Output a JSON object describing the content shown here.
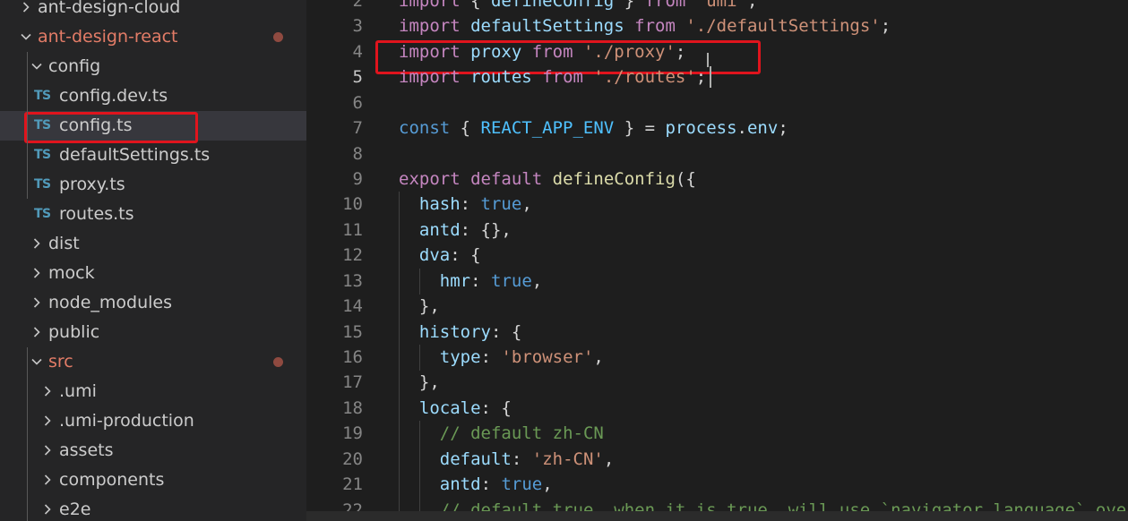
{
  "explorer": {
    "items": [
      {
        "label": "ant-design-cloud",
        "type": "folder",
        "state": "collapsed",
        "depth": 0,
        "modified": false,
        "selected": false
      },
      {
        "label": "ant-design-react",
        "type": "folder",
        "state": "expanded",
        "depth": 0,
        "modified": true,
        "selected": false
      },
      {
        "label": "config",
        "type": "folder",
        "state": "expanded",
        "depth": 1,
        "modified": false,
        "selected": false
      },
      {
        "label": "config.dev.ts",
        "type": "ts-file",
        "depth": 2,
        "modified": false,
        "selected": false
      },
      {
        "label": "config.ts",
        "type": "ts-file",
        "depth": 2,
        "modified": false,
        "selected": true,
        "highlighted": true
      },
      {
        "label": "defaultSettings.ts",
        "type": "ts-file",
        "depth": 2,
        "modified": false,
        "selected": false
      },
      {
        "label": "proxy.ts",
        "type": "ts-file",
        "depth": 2,
        "modified": false,
        "selected": false
      },
      {
        "label": "routes.ts",
        "type": "ts-file",
        "depth": 2,
        "modified": false,
        "selected": false
      },
      {
        "label": "dist",
        "type": "folder",
        "state": "collapsed",
        "depth": 1,
        "modified": false,
        "selected": false
      },
      {
        "label": "mock",
        "type": "folder",
        "state": "collapsed",
        "depth": 1,
        "modified": false,
        "selected": false
      },
      {
        "label": "node_modules",
        "type": "folder",
        "state": "collapsed",
        "depth": 1,
        "modified": false,
        "selected": false
      },
      {
        "label": "public",
        "type": "folder",
        "state": "collapsed",
        "depth": 1,
        "modified": false,
        "selected": false
      },
      {
        "label": "src",
        "type": "folder",
        "state": "expanded",
        "depth": 1,
        "modified": true,
        "selected": false
      },
      {
        "label": ".umi",
        "type": "folder",
        "state": "collapsed",
        "depth": 2,
        "modified": false,
        "selected": false
      },
      {
        "label": ".umi-production",
        "type": "folder",
        "state": "collapsed",
        "depth": 2,
        "modified": false,
        "selected": false
      },
      {
        "label": "assets",
        "type": "folder",
        "state": "collapsed",
        "depth": 2,
        "modified": false,
        "selected": false
      },
      {
        "label": "components",
        "type": "folder",
        "state": "collapsed",
        "depth": 2,
        "modified": false,
        "selected": false
      },
      {
        "label": "e2e",
        "type": "folder",
        "state": "collapsed",
        "depth": 2,
        "modified": false,
        "selected": false
      }
    ],
    "ts_icon_label": "TS"
  },
  "editor": {
    "active_line": 5,
    "highlighted_line": 4,
    "lines": [
      {
        "n": "2",
        "indent": 0,
        "tokens": [
          {
            "t": "import",
            "c": "kw"
          },
          {
            "t": " { ",
            "c": "p"
          },
          {
            "t": "defineConfig",
            "c": "var"
          },
          {
            "t": " } ",
            "c": "p"
          },
          {
            "t": "from",
            "c": "kw"
          },
          {
            "t": " ",
            "c": "p"
          },
          {
            "t": "'umi'",
            "c": "str"
          },
          {
            "t": ";",
            "c": "p"
          }
        ]
      },
      {
        "n": "3",
        "indent": 0,
        "tokens": [
          {
            "t": "import",
            "c": "kw"
          },
          {
            "t": " ",
            "c": "p"
          },
          {
            "t": "defaultSettings",
            "c": "var"
          },
          {
            "t": " ",
            "c": "p"
          },
          {
            "t": "from",
            "c": "kw"
          },
          {
            "t": " ",
            "c": "p"
          },
          {
            "t": "'./defaultSettings'",
            "c": "str"
          },
          {
            "t": ";",
            "c": "p"
          }
        ]
      },
      {
        "n": "4",
        "indent": 0,
        "tokens": [
          {
            "t": "import",
            "c": "kw"
          },
          {
            "t": " ",
            "c": "p"
          },
          {
            "t": "proxy",
            "c": "var"
          },
          {
            "t": " ",
            "c": "p"
          },
          {
            "t": "from",
            "c": "kw"
          },
          {
            "t": " ",
            "c": "p"
          },
          {
            "t": "'./proxy'",
            "c": "str"
          },
          {
            "t": ";",
            "c": "p"
          }
        ]
      },
      {
        "n": "5",
        "indent": 0,
        "tokens": [
          {
            "t": "import",
            "c": "kw"
          },
          {
            "t": " ",
            "c": "p"
          },
          {
            "t": "routes",
            "c": "var"
          },
          {
            "t": " ",
            "c": "p"
          },
          {
            "t": "from",
            "c": "kw"
          },
          {
            "t": " ",
            "c": "p"
          },
          {
            "t": "'./routes'",
            "c": "str"
          },
          {
            "t": ";",
            "c": "p"
          }
        ]
      },
      {
        "n": "6",
        "indent": 0,
        "tokens": []
      },
      {
        "n": "7",
        "indent": 0,
        "tokens": [
          {
            "t": "const",
            "c": "const"
          },
          {
            "t": " { ",
            "c": "p"
          },
          {
            "t": "REACT_APP_ENV",
            "c": "cst"
          },
          {
            "t": " } = ",
            "c": "p"
          },
          {
            "t": "process",
            "c": "var"
          },
          {
            "t": ".",
            "c": "p"
          },
          {
            "t": "env",
            "c": "var"
          },
          {
            "t": ";",
            "c": "p"
          }
        ]
      },
      {
        "n": "8",
        "indent": 0,
        "tokens": []
      },
      {
        "n": "9",
        "indent": 0,
        "tokens": [
          {
            "t": "export",
            "c": "kw"
          },
          {
            "t": " ",
            "c": "p"
          },
          {
            "t": "default",
            "c": "kw"
          },
          {
            "t": " ",
            "c": "p"
          },
          {
            "t": "defineConfig",
            "c": "fn"
          },
          {
            "t": "({",
            "c": "p"
          }
        ]
      },
      {
        "n": "10",
        "indent": 1,
        "tokens": [
          {
            "t": "hash",
            "c": "var"
          },
          {
            "t": ": ",
            "c": "p"
          },
          {
            "t": "true",
            "c": "const"
          },
          {
            "t": ",",
            "c": "p"
          }
        ]
      },
      {
        "n": "11",
        "indent": 1,
        "tokens": [
          {
            "t": "antd",
            "c": "var"
          },
          {
            "t": ": {},",
            "c": "p"
          }
        ]
      },
      {
        "n": "12",
        "indent": 1,
        "tokens": [
          {
            "t": "dva",
            "c": "var"
          },
          {
            "t": ": {",
            "c": "p"
          }
        ]
      },
      {
        "n": "13",
        "indent": 2,
        "tokens": [
          {
            "t": "hmr",
            "c": "var"
          },
          {
            "t": ": ",
            "c": "p"
          },
          {
            "t": "true",
            "c": "const"
          },
          {
            "t": ",",
            "c": "p"
          }
        ]
      },
      {
        "n": "14",
        "indent": 1,
        "tokens": [
          {
            "t": "},",
            "c": "p"
          }
        ]
      },
      {
        "n": "15",
        "indent": 1,
        "tokens": [
          {
            "t": "history",
            "c": "var"
          },
          {
            "t": ": {",
            "c": "p"
          }
        ]
      },
      {
        "n": "16",
        "indent": 2,
        "tokens": [
          {
            "t": "type",
            "c": "var"
          },
          {
            "t": ": ",
            "c": "p"
          },
          {
            "t": "'browser'",
            "c": "str"
          },
          {
            "t": ",",
            "c": "p"
          }
        ]
      },
      {
        "n": "17",
        "indent": 1,
        "tokens": [
          {
            "t": "},",
            "c": "p"
          }
        ]
      },
      {
        "n": "18",
        "indent": 1,
        "tokens": [
          {
            "t": "locale",
            "c": "var"
          },
          {
            "t": ": {",
            "c": "p"
          }
        ]
      },
      {
        "n": "19",
        "indent": 2,
        "tokens": [
          {
            "t": "// default zh-CN",
            "c": "cmt"
          }
        ]
      },
      {
        "n": "20",
        "indent": 2,
        "tokens": [
          {
            "t": "default",
            "c": "var"
          },
          {
            "t": ": ",
            "c": "p"
          },
          {
            "t": "'zh-CN'",
            "c": "str"
          },
          {
            "t": ",",
            "c": "p"
          }
        ]
      },
      {
        "n": "21",
        "indent": 2,
        "tokens": [
          {
            "t": "antd",
            "c": "var"
          },
          {
            "t": ": ",
            "c": "p"
          },
          {
            "t": "true",
            "c": "const"
          },
          {
            "t": ",",
            "c": "p"
          }
        ]
      },
      {
        "n": "22",
        "indent": 2,
        "tokens": [
          {
            "t": "// default true, when it is true, will use `navigator.language` overwrite default",
            "c": "cmt"
          }
        ]
      }
    ]
  },
  "colors": {
    "kw": "#c586c0",
    "var": "#9cdcfe",
    "fn": "#dcdcaa",
    "str": "#ce9178",
    "const": "#569cd6",
    "cst": "#4fc1ff",
    "cmt": "#6a9955",
    "p": "#d4d4d4",
    "highlight": "#e0141d"
  }
}
